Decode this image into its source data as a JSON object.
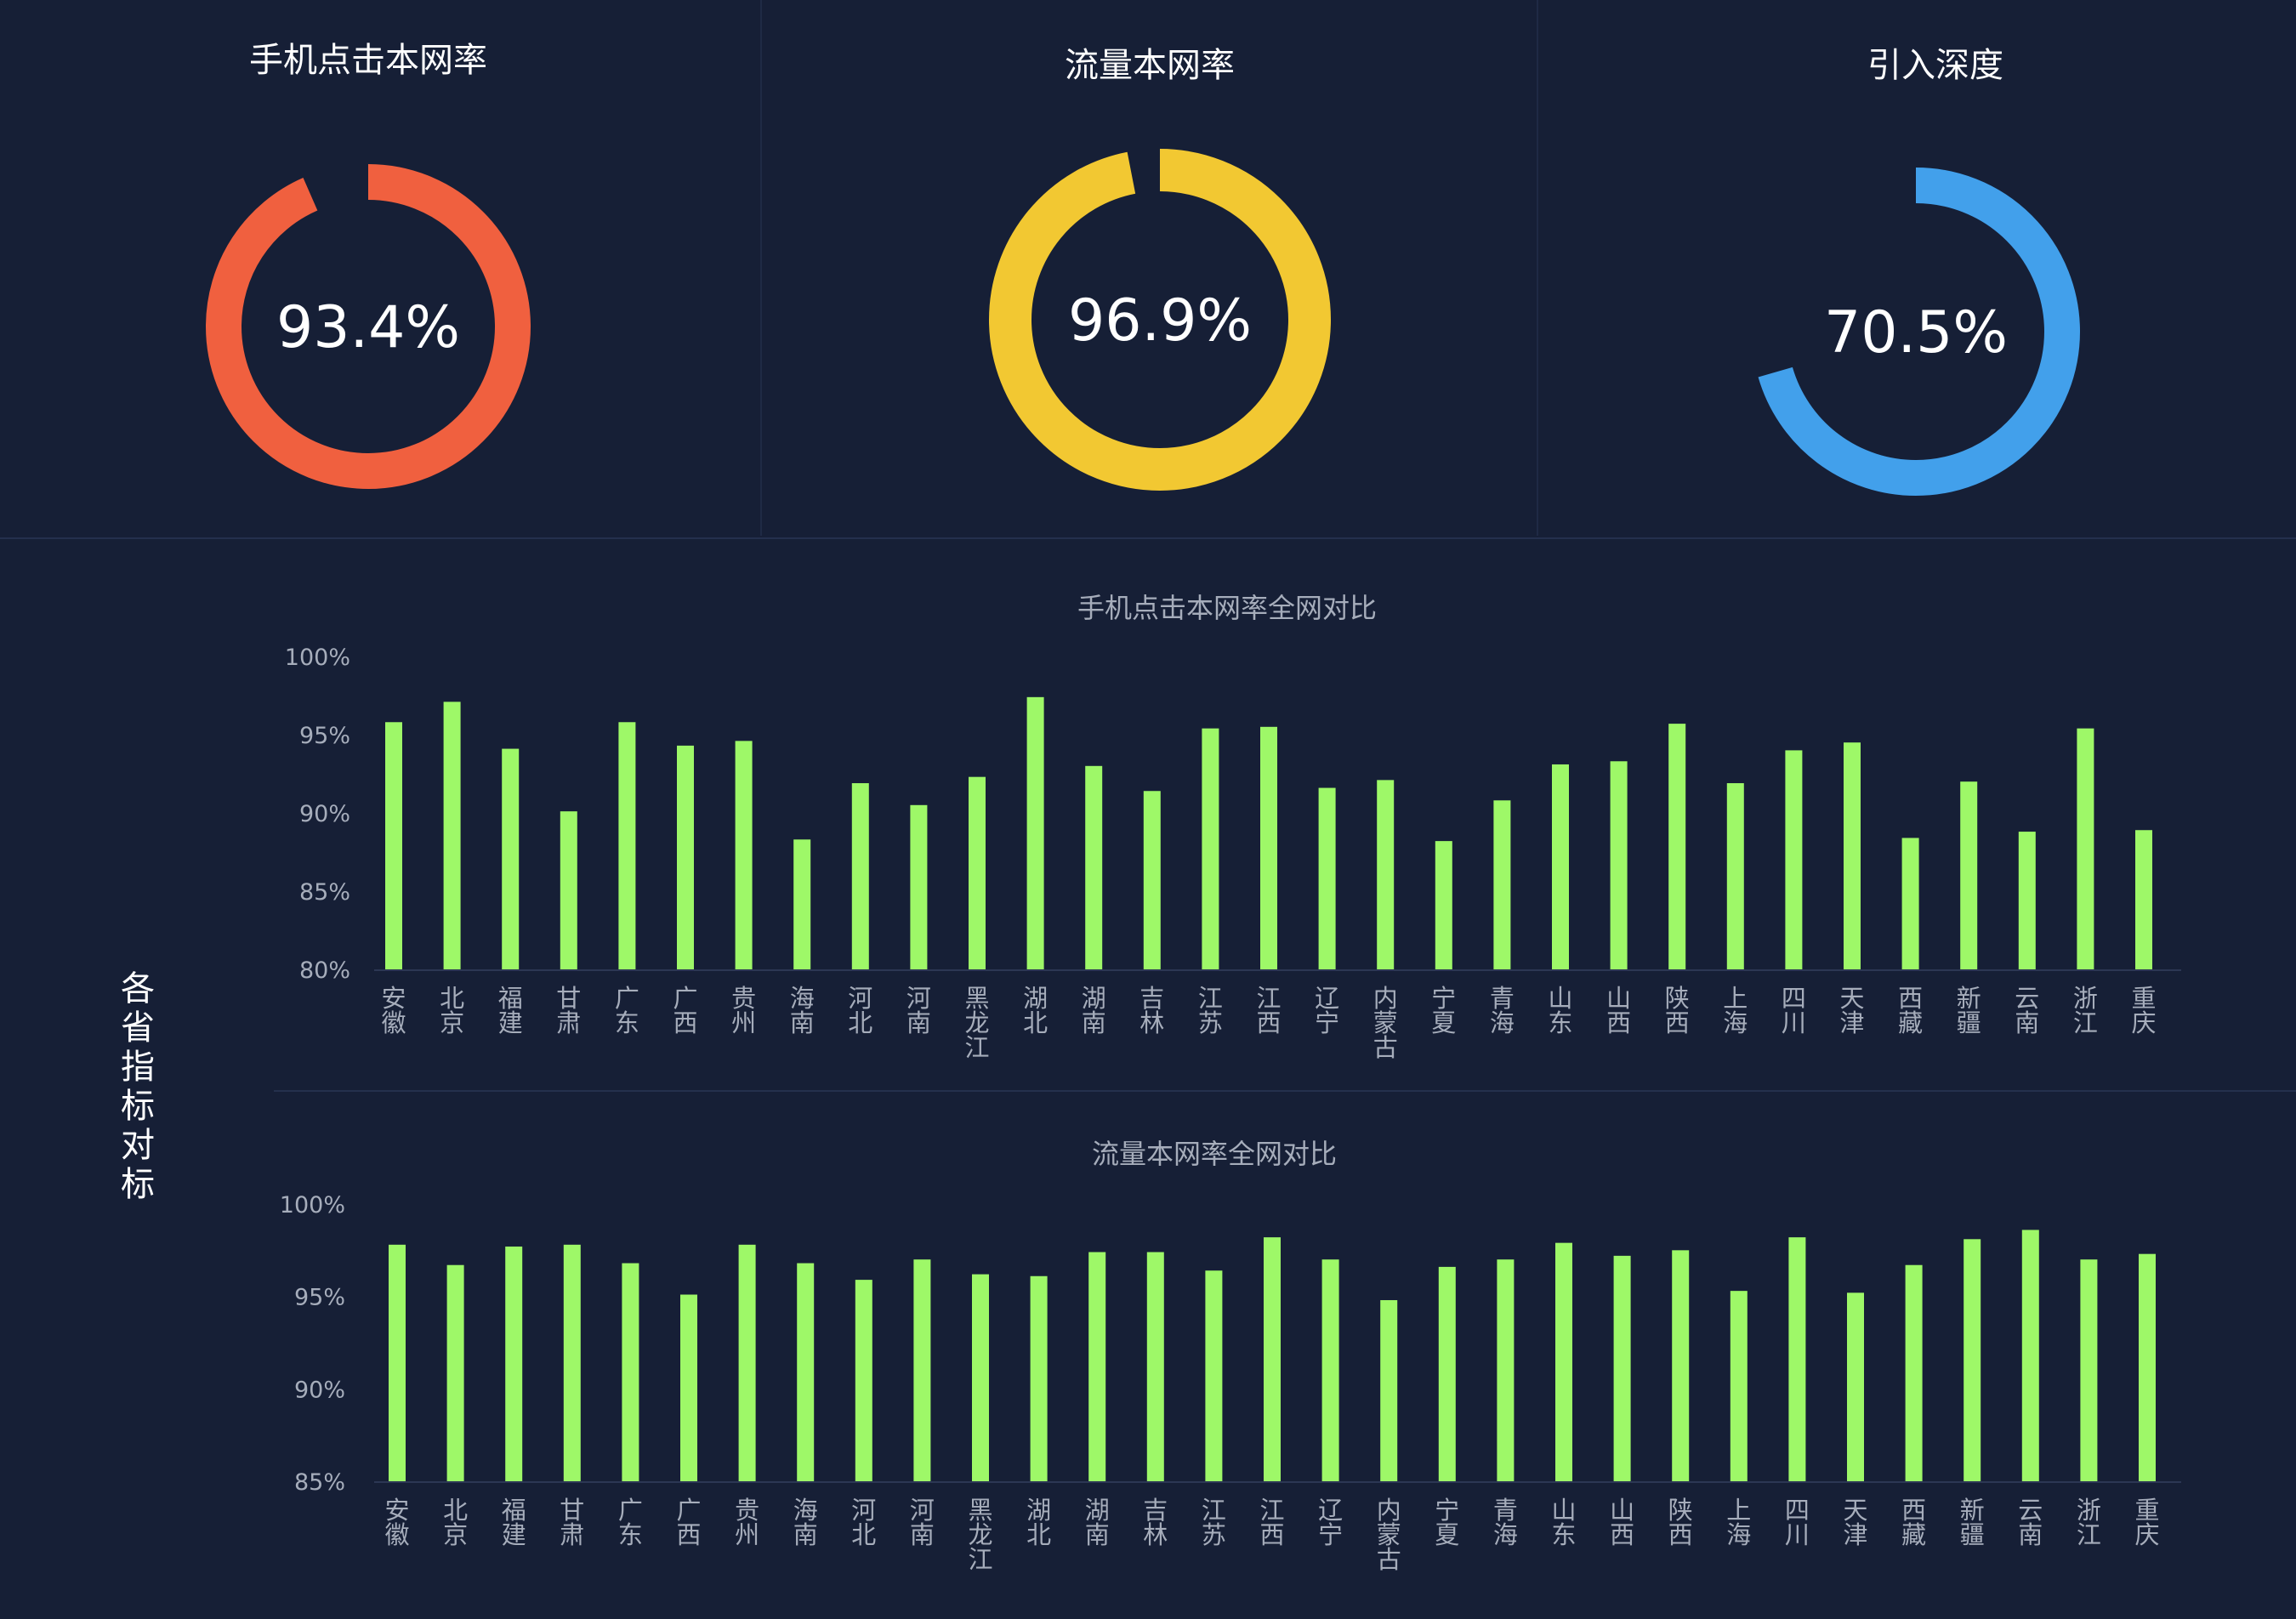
{
  "gauges": [
    {
      "title": "手机点击本网率",
      "value": 93.4,
      "label": "93.4%",
      "color": "#f0603f"
    },
    {
      "title": "流量本网率",
      "value": 96.9,
      "label": "96.9%",
      "color": "#f2c832"
    },
    {
      "title": "引入深度",
      "value": 70.5,
      "label": "70.5%",
      "color": "#42a0eb"
    }
  ],
  "side_label": "各省指标对标",
  "bar_color": "#9ef868",
  "chart_data": [
    {
      "type": "bar",
      "title": "手机点击本网率全网对比",
      "ylim": [
        80,
        100
      ],
      "yticks": [
        80,
        85,
        90,
        95,
        100
      ],
      "ytick_labels": [
        "80%",
        "85%",
        "90%",
        "95%",
        "100%"
      ],
      "categories": [
        "安徽",
        "北京",
        "福建",
        "甘肃",
        "广东",
        "广西",
        "贵州",
        "海南",
        "河北",
        "河南",
        "黑龙江",
        "湖北",
        "湖南",
        "吉林",
        "江苏",
        "江西",
        "辽宁",
        "内蒙古",
        "宁夏",
        "青海",
        "山东",
        "山西",
        "陕西",
        "上海",
        "四川",
        "天津",
        "西藏",
        "新疆",
        "云南",
        "浙江",
        "重庆"
      ],
      "values": [
        95.8,
        97.1,
        94.1,
        90.1,
        95.8,
        94.3,
        94.6,
        88.3,
        91.9,
        90.5,
        92.3,
        97.4,
        93.0,
        91.4,
        95.4,
        95.5,
        91.6,
        92.1,
        88.2,
        90.8,
        93.1,
        93.3,
        95.7,
        91.9,
        94.0,
        94.5,
        88.4,
        92.0,
        88.8,
        95.4,
        88.9
      ]
    },
    {
      "type": "bar",
      "title": "流量本网率全网对比",
      "ylim": [
        85,
        100
      ],
      "yticks": [
        85,
        90,
        95,
        100
      ],
      "ytick_labels": [
        "85%",
        "90%",
        "95%",
        "100%"
      ],
      "categories": [
        "安徽",
        "北京",
        "福建",
        "甘肃",
        "广东",
        "广西",
        "贵州",
        "海南",
        "河北",
        "河南",
        "黑龙江",
        "湖北",
        "湖南",
        "吉林",
        "江苏",
        "江西",
        "辽宁",
        "内蒙古",
        "宁夏",
        "青海",
        "山东",
        "山西",
        "陕西",
        "上海",
        "四川",
        "天津",
        "西藏",
        "新疆",
        "云南",
        "浙江",
        "重庆"
      ],
      "values": [
        97.8,
        96.7,
        97.7,
        97.8,
        96.8,
        95.1,
        97.8,
        96.8,
        95.9,
        97.0,
        96.2,
        96.1,
        97.4,
        97.4,
        96.4,
        98.2,
        97.0,
        94.8,
        96.6,
        97.0,
        97.9,
        97.2,
        97.5,
        95.3,
        98.2,
        95.2,
        96.7,
        98.1,
        98.6,
        97.0,
        97.3
      ]
    }
  ]
}
